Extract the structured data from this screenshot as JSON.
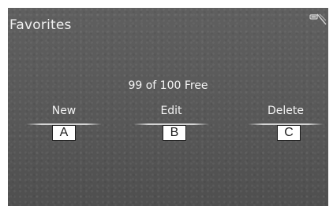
{
  "screen": {
    "title": "Favorites",
    "free_count": "99 of 100 Free",
    "icons": {
      "status": "signal-status-icon"
    }
  },
  "actions": [
    {
      "label": "New"
    },
    {
      "label": "Edit"
    },
    {
      "label": "Delete"
    }
  ],
  "callouts": [
    "A",
    "B",
    "C"
  ]
}
